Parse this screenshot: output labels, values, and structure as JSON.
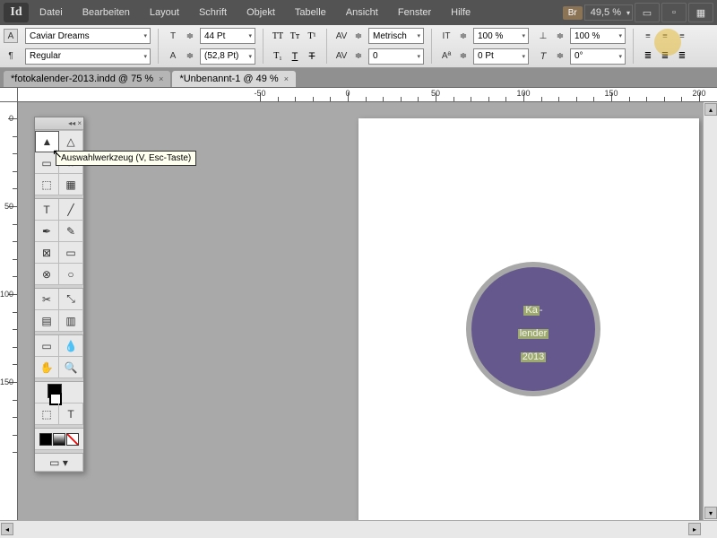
{
  "app_logo": "Id",
  "menus": [
    "Datei",
    "Bearbeiten",
    "Layout",
    "Schrift",
    "Objekt",
    "Tabelle",
    "Ansicht",
    "Fenster",
    "Hilfe"
  ],
  "bridge_badge": "Br",
  "zoom_value": "49,5 %",
  "control": {
    "font_family": "Caviar Dreams",
    "font_style": "Regular",
    "font_size": "44 Pt",
    "leading": "(52,8 Pt)",
    "kerning": "Metrisch",
    "tracking": "0",
    "vscale": "100 %",
    "hscale": "100 %",
    "baseline": "0 Pt",
    "skew": "0°"
  },
  "tabs": [
    {
      "label": "*fotokalender-2013.indd @ 75 %",
      "active": false
    },
    {
      "label": "*Unbenannt-1 @ 49 %",
      "active": true
    }
  ],
  "tooltip": "Auswahlwerkzeug (V, Esc-Taste)",
  "ruler_h": [
    "0",
    "50",
    "100",
    "150",
    "200"
  ],
  "ruler_h_start": -9,
  "ruler_v": [
    "0",
    "50",
    "100",
    "150"
  ],
  "circle_text": {
    "line1a": "Ka",
    "line1b": "-",
    "line2": "lender",
    "line3": "2013"
  },
  "chart_data": null
}
